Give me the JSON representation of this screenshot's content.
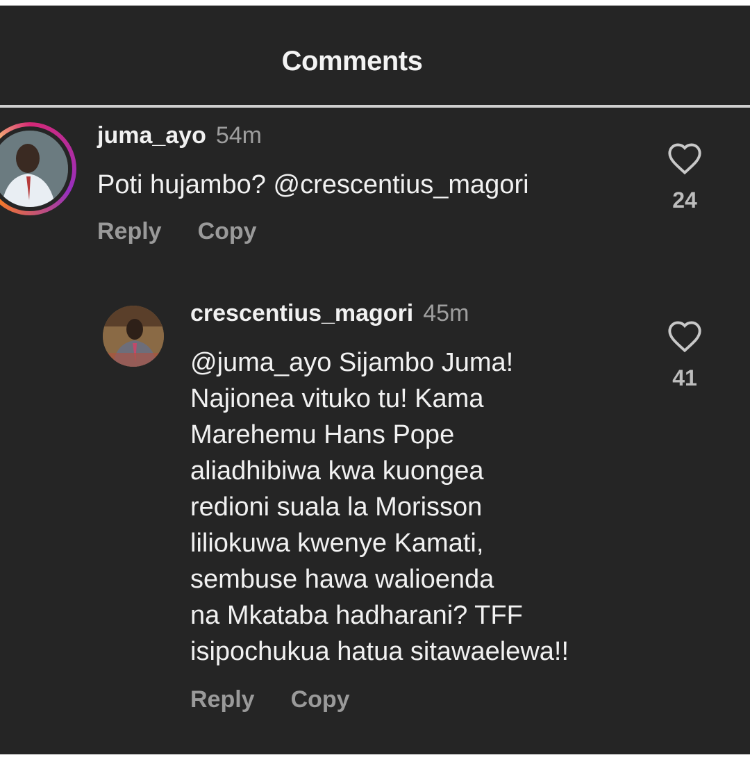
{
  "header": {
    "title": "Comments"
  },
  "comments": [
    {
      "username": "juma_ayo",
      "time": "54m",
      "text": "Poti hujambo? @crescentius_magori",
      "likes": "24",
      "reply_label": "Reply",
      "copy_label": "Copy"
    },
    {
      "username": "crescentius_magori",
      "time": "45m",
      "text": "@juma_ayo Sijambo Juma!\nNajionea vituko tu! Kama\nMarehemu Hans Pope\naliadhibiwa kwa kuongea\nredioni suala la Morisson\nliliokuwa kwenye Kamati,\nsembuse hawa walioenda\nna Mkataba hadharani? TFF\nisipochukua hatua sitawaelewa!!",
      "likes": "41",
      "reply_label": "Reply",
      "copy_label": "Copy"
    }
  ],
  "icons": {
    "like": "heart-outline-icon"
  },
  "colors": {
    "background": "#252525",
    "text": "#f1f1f1",
    "muted": "#9e9e9e"
  }
}
